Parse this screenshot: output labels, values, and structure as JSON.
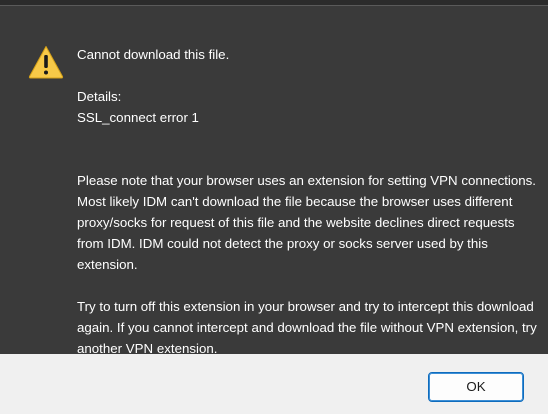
{
  "dialog": {
    "icon": "warning-icon",
    "title_message": "Cannot download this file.",
    "details_label": "Details:",
    "details_value": "SSL_connect error 1",
    "paragraph_1": "Please note that your browser uses an extension for setting VPN connections. Most likely IDM can't download the file because the browser uses different proxy/socks for request of this file and the website declines direct requests from IDM. IDM could not detect the proxy or socks server used by this extension.",
    "paragraph_2": "Try to turn off this extension in your browser and try to intercept this download again. If you cannot intercept and download the file without VPN extension, try another VPN extension."
  },
  "footer": {
    "ok_label": "OK"
  },
  "colors": {
    "body_background": "#3a3a3a",
    "footer_background": "#f0f0f0",
    "warning_yellow": "#f7c948",
    "button_border": "#0f6cbd"
  }
}
